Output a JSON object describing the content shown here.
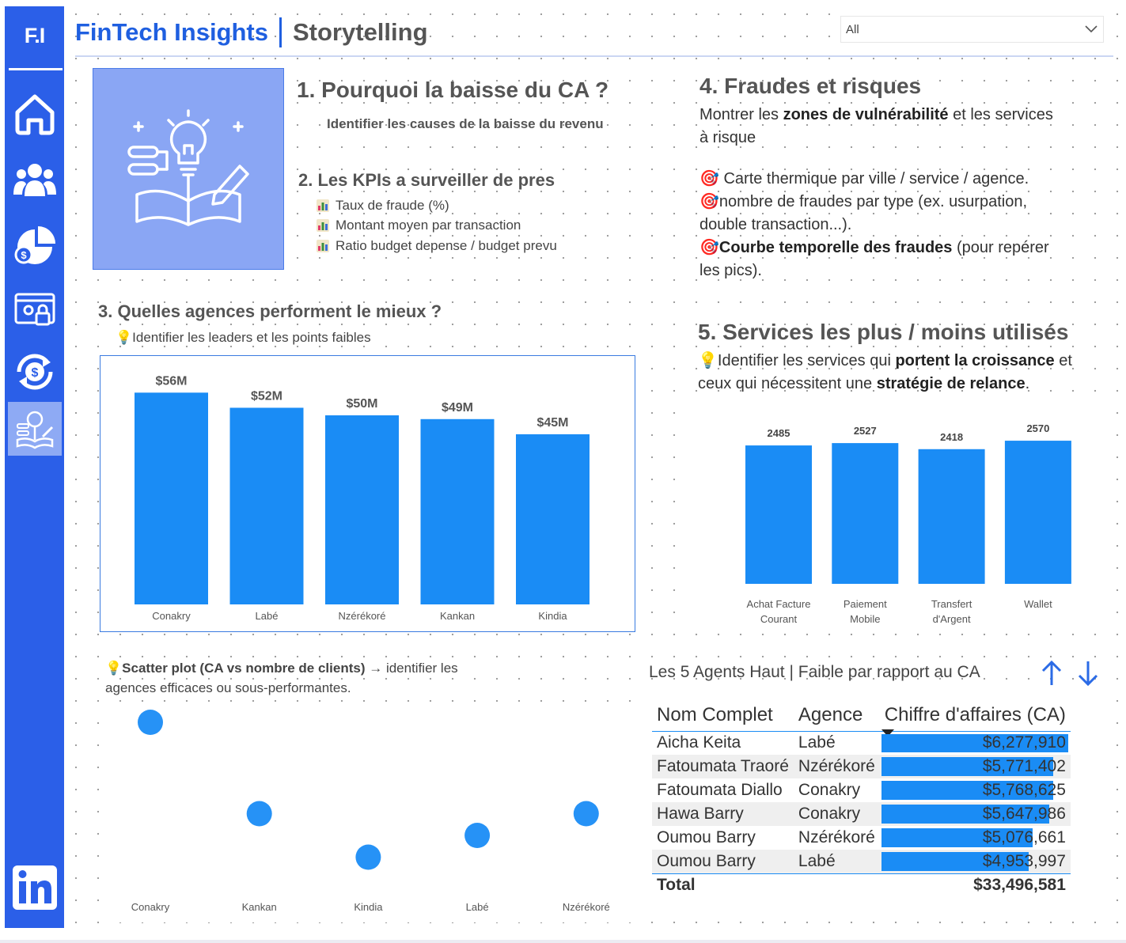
{
  "header": {
    "brand": "FinTech Insights",
    "page": "Storytelling"
  },
  "slicer": {
    "value": "All"
  },
  "sidebar": {
    "logo": "F.I",
    "items": [
      {
        "icon": "home-icon"
      },
      {
        "icon": "users-icon"
      },
      {
        "icon": "finance-pie-icon"
      },
      {
        "icon": "security-dashboard-icon"
      },
      {
        "icon": "currency-exchange-icon"
      },
      {
        "icon": "storytelling-idea-icon",
        "active": true
      }
    ],
    "footer_icon": "linkedin-icon"
  },
  "sections": {
    "s1": {
      "title": "1. Pourquoi la baisse du CA ?",
      "subtitle": "Identifier les causes de la baisse du revenu"
    },
    "s2": {
      "title": "2. Les KPIs a surveiller de pres",
      "items": [
        "Taux de fraude (%)",
        "Montant moyen par transaction",
        "Ratio budget depense / budget prevu"
      ]
    },
    "s3": {
      "title": "3. Quelles agences performent le mieux ?",
      "subtitle": "Identifier les leaders et les points faibles"
    },
    "s4": {
      "title": "4. Fraudes et risques",
      "intro_pre": "Montrer les ",
      "intro_bold": "zones de vulnérabilité",
      "intro_post": " et les services",
      "intro_line2": "à risque",
      "b1": "Carte thermique par ville / service / agence.",
      "b2_l1": "nombre de fraudes par type (ex. usurpation,",
      "b2_l2": "double transaction...).",
      "b3_bold": "Courbe temporelle des fraudes",
      "b3_post": " (pour repérer",
      "b3_l2": "les pics)."
    },
    "s5": {
      "title": "5. Services les plus / moins utilisés",
      "l1_pre": "Identifier les services qui ",
      "l1_bold": "portent la croissance",
      "l1_post": " et",
      "l2_pre": "ceux qui nécessitent une ",
      "l2_bold": "stratégie de relance",
      "l2_post": "."
    },
    "s6": {
      "bold": "Scatter plot (CA vs nombre de clients)",
      "post": " → identifier les",
      "l2": "agences efficaces ou sous-performantes."
    }
  },
  "chart_data": [
    {
      "type": "bar",
      "categories": [
        "Conakry",
        "Labé",
        "Nzérékoré",
        "Kankan",
        "Kindia"
      ],
      "values": [
        56,
        52,
        50,
        49,
        45
      ],
      "labels": [
        "$56M",
        "$52M",
        "$50M",
        "$49M",
        "$45M"
      ],
      "unit": "$M",
      "color": "#1a8cf5"
    },
    {
      "type": "bar",
      "categories": [
        "Achat Facture Courant",
        "Paiement Mobile",
        "Transfert d'Argent",
        "Wallet"
      ],
      "category_lines": [
        [
          "Achat Facture",
          "Courant"
        ],
        [
          "Paiement",
          "Mobile"
        ],
        [
          "Transfert",
          "d'Argent"
        ],
        [
          "Wallet"
        ]
      ],
      "values": [
        2485,
        2527,
        2418,
        2570
      ],
      "color": "#1a8cf5"
    },
    {
      "type": "scatter",
      "categories": [
        "Conakry",
        "Kankan",
        "Kindia",
        "Labé",
        "Nzérékoré"
      ],
      "values": [
        100,
        58,
        38,
        48,
        58
      ],
      "color": "#1a8cf5"
    }
  ],
  "table": {
    "title": "Les 5 Agents Haut | Faible par rapport au CA",
    "columns": [
      "Nom Complet",
      "Agence",
      "Chiffre d'affaires (CA)"
    ],
    "rows": [
      {
        "name": "Aicha Keita",
        "agence": "Labé",
        "ca": "$6,277,910",
        "value": 6277910
      },
      {
        "name": "Fatoumata Traoré",
        "agence": "Nzérékoré",
        "ca": "$5,771,402",
        "value": 5771402
      },
      {
        "name": "Fatoumata Diallo",
        "agence": "Conakry",
        "ca": "$5,768,625",
        "value": 5768625
      },
      {
        "name": "Hawa Barry",
        "agence": "Conakry",
        "ca": "$5,647,986",
        "value": 5647986
      },
      {
        "name": "Oumou Barry",
        "agence": "Nzérékoré",
        "ca": "$5,076,661",
        "value": 5076661
      },
      {
        "name": "Oumou Barry",
        "agence": "Labé",
        "ca": "$4,953,997",
        "value": 4953997
      }
    ],
    "total_label": "Total",
    "total_value": "$33,496,581"
  },
  "colors": {
    "accent": "#2b5fe8",
    "bar": "#1a8cf5",
    "hero": "#8aa6f4"
  }
}
